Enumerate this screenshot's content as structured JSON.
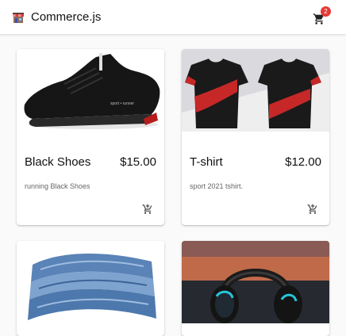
{
  "app": {
    "brand": "Commerce.js",
    "cart_count": "2"
  },
  "products": [
    {
      "name": "Black Shoes",
      "price": "$15.00",
      "description": "running Black Shoes",
      "image_icon": "shoe-image"
    },
    {
      "name": "T-shirt",
      "price": "$12.00",
      "description": "sport 2021 tshirt.",
      "image_icon": "tshirt-image"
    },
    {
      "name": "",
      "price": "",
      "description": "",
      "image_icon": "jeans-image"
    },
    {
      "name": "",
      "price": "",
      "description": "",
      "image_icon": "headset-image"
    }
  ],
  "colors": {
    "badge": "#e53935",
    "text": "#111111",
    "muted": "#666666"
  }
}
